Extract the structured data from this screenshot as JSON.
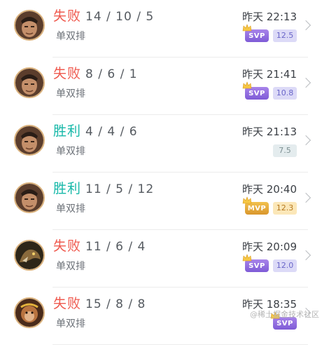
{
  "matches": [
    {
      "result": "失败",
      "outcome": "lose",
      "kda": "14 / 10 / 5",
      "mode": "单双排",
      "time": "昨天 22:13",
      "medal": "SVP",
      "score": "12.5",
      "score_style": "purple",
      "hero": "warrior"
    },
    {
      "result": "失败",
      "outcome": "lose",
      "kda": "8 / 6 / 1",
      "mode": "单双排",
      "time": "昨天 21:41",
      "medal": "SVP",
      "score": "10.8",
      "score_style": "purple",
      "hero": "warrior"
    },
    {
      "result": "胜利",
      "outcome": "win",
      "kda": "4 / 4 / 6",
      "mode": "单双排",
      "time": "昨天 21:13",
      "medal": "",
      "score": "7.5",
      "score_style": "gray",
      "hero": "warrior"
    },
    {
      "result": "胜利",
      "outcome": "win",
      "kda": "11 / 5 / 12",
      "mode": "单双排",
      "time": "昨天 20:40",
      "medal": "MVP",
      "score": "12.3",
      "score_style": "gold",
      "hero": "warrior"
    },
    {
      "result": "失败",
      "outcome": "lose",
      "kda": "11 / 6 / 4",
      "mode": "单双排",
      "time": "昨天 20:09",
      "medal": "SVP",
      "score": "12.0",
      "score_style": "purple",
      "hero": "beast"
    },
    {
      "result": "失败",
      "outcome": "lose",
      "kda": "15 / 8 / 8",
      "mode": "单双排",
      "time": "昨天 18:35",
      "medal": "SVP",
      "score": "",
      "score_style": "purple",
      "hero": "monkey"
    }
  ],
  "watermark": "@稀土掘金技术社区",
  "colors": {
    "lose": "#ef5a4f",
    "win": "#16b8a8",
    "svp": "#8e6ade",
    "mvp": "#e3a63a"
  },
  "icons": {
    "crown": "crown-icon",
    "chevron": "chevron-right-icon"
  }
}
